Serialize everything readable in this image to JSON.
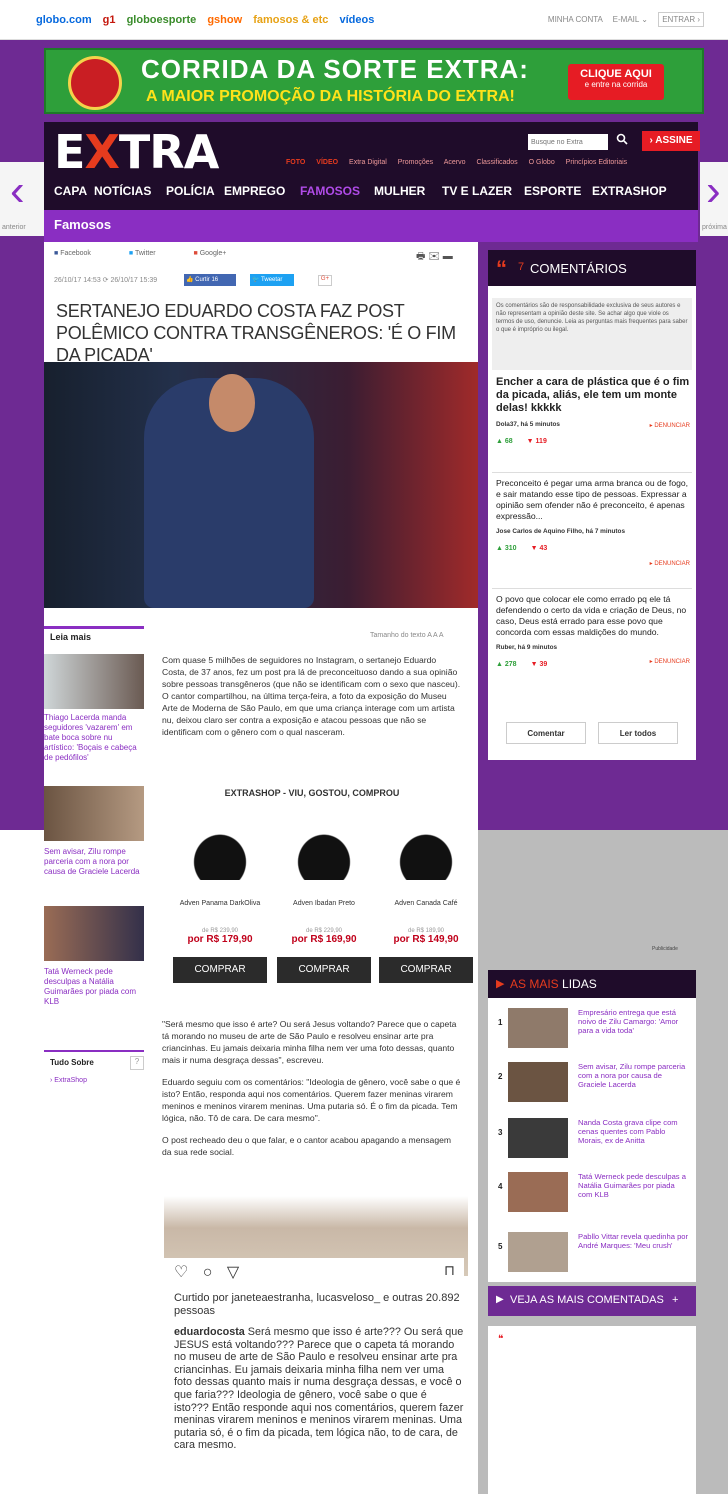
{
  "topbar": {
    "links": [
      "globo.com",
      "g1",
      "globoesporte",
      "gshow",
      "famosos & etc",
      "vídeos"
    ],
    "right": [
      "MINHA CONTA",
      "E-MAIL ⌄",
      "ENTRAR ›"
    ]
  },
  "banner": {
    "title": "CORRIDA DA SORTE EXTRA:",
    "subtitle": "A MAIOR PROMOÇÃO DA HISTÓRIA DO EXTRA!",
    "btn_title": "CLIQUE AQUI",
    "btn_sub": "e entre na corrida",
    "seal": "CORRIDA DA SORTE EXTRA"
  },
  "header": {
    "logo_e": "E",
    "logo_x": "X",
    "logo_rest": "TRA",
    "search_placeholder": "Busque no Extra",
    "assine": "› ASSINE",
    "subnav": [
      "FOTO",
      "VÍDEO",
      "Extra Digital",
      "Promoções",
      "Acervo",
      "Classificados",
      "O Globo",
      "Princípios Editoriais"
    ]
  },
  "mainnav": [
    "CAPA",
    "NOTÍCIAS",
    "POLÍCIA",
    "EMPREGO",
    "FAMOSOS",
    "MULHER",
    "TV E LAZER",
    "ESPORTE",
    "EXTRASHOP"
  ],
  "section": "Famosos",
  "arrows": {
    "prev": "anterior",
    "next": "próxima"
  },
  "share": {
    "facebook": "Facebook",
    "twitter": "Twitter",
    "google": "Google+",
    "dates": "26/10/17 14:53  ⟳ 26/10/17 15:39",
    "curtir": "👍 Curtir 16",
    "tweet": "🐦 Tweetar",
    "g1": "G+"
  },
  "headline": "SERTANEJO EDUARDO COSTA FAZ POST POLÊMICO CONTRA TRANSGÊNEROS: 'É O FIM DA PICADA'",
  "leia_mais": {
    "title": "Leia mais",
    "items": [
      "Thiago Lacerda manda seguidores 'vazarem' em bate boca sobre nu artístico: 'Boçais e cabeça de pedófilos'",
      "Sem avisar, Zilu rompe parceria com a nora por causa de Graciele Lacerda",
      "Tatá Werneck pede desculpas a Natália Guimarães por piada com KLB"
    ]
  },
  "tamanho": "Tamanho do texto  A  A  A",
  "body1": "Com quase 5 milhões de seguidores no Instagram, o sertanejo Eduardo Costa, de 37 anos, fez um post pra lá de preconceituoso dando a sua opinião sobre pessoas transgêneros (que não se identificam com o sexo que nasceu). O cantor compartilhou, na última terça-feira, a foto da exposição do Museu Arte de Moderna de São Paulo, em que uma criança interage com um artista nu, deixou claro ser contra a exposição e atacou pessoas que não se identificam com o gênero com o qual nasceram.",
  "shop": {
    "title": "EXTRASHOP - VIU, GOSTOU, COMPROU",
    "products": [
      {
        "name": "Adven Panama DarkOliva",
        "old": "de R$ 239,90",
        "price": "por R$ 179,90",
        "buy": "COMPRAR"
      },
      {
        "name": "Adven Ibadan Preto",
        "old": "de R$ 229,90",
        "price": "por R$ 169,90",
        "buy": "COMPRAR"
      },
      {
        "name": "Adven Canada Café",
        "old": "de R$ 189,90",
        "price": "por R$ 149,90",
        "buy": "COMPRAR"
      }
    ]
  },
  "body2": [
    "\"Será mesmo que isso é arte? Ou será Jesus voltando? Parece que o capeta tá morando no museu de arte de São Paulo e resolveu ensinar arte pra criancinhas. Eu jamais deixaria minha filha nem ver uma foto dessas, quanto mais ir numa desgraça dessas\", escreveu.",
    "Eduardo seguiu com os comentários: \"Ideologia de gênero, você sabe o que é isto? Então, responda aqui nos comentários. Querem fazer meninas virarem meninos e meninos virarem meninas. Uma putaria só. É o fim da picada. Tem lógica, não. Tô de cara. De cara mesmo\".",
    "O post recheado deu o que falar, e o cantor acabou apagando a mensagem da sua rede social."
  ],
  "tudo": {
    "title": "Tudo Sobre",
    "q": "?",
    "item": "› ExtraShop"
  },
  "insta": {
    "curtido": "Curtido por janeteaestranha, lucasveloso_ e outras 20.892 pessoas",
    "user": "eduardocosta",
    "caption": "Será mesmo que isso é arte??? Ou será que JESUS está voltando??? Parece que o capeta tá morando no museu  de arte de São Paulo e resolveu ensinar arte pra criancinhas. Eu jamais deixaria minha filha nem ver uma foto dessas quanto mais ir numa desgraça dessas, e você o que faria??? Ideologia de gênero, você sabe o que é isto??? Então responde aqui nos comentários, querem fazer meninas virarem meninos e meninos virarem meninas. Uma putaria só, é o fim da picada, tem lógica não, to de cara, de cara mesmo."
  },
  "comments": {
    "count": "7",
    "title": "COMENTÁRIOS",
    "disclaimer": "Os comentários são de responsabilidade exclusiva de seus autores e não representam a opinião deste site. Se achar algo que viole os termos de uso, denuncie. Leia as perguntas mais frequentes para saber o que é impróprio ou ilegal.",
    "denunciar": "▸ DENUNCIAR",
    "items": [
      {
        "text": "Encher a cara de plástica que é o fim da picada, aliás, ele tem um monte delas! kkkkk",
        "author": "Dola37, há 5 minutos",
        "up": "68",
        "down": "119"
      },
      {
        "text": "Preconceito é pegar uma arma branca ou de fogo, e sair matando esse tipo de pessoas. Expressar a opinião sem ofender não é preconceito, é apenas expressão...",
        "author": "Jose Carlos de Aquino Filho, há 7 minutos",
        "up": "310",
        "down": "43"
      },
      {
        "text": "O povo que colocar ele como errado pq ele tá defendendo o certo da vida e criação de Deus, no caso, Deus está errado para esse povo que concorda com essas maldições do mundo.",
        "author": "Ruber, há 9 minutos",
        "up": "278",
        "down": "39"
      }
    ],
    "comentar": "Comentar",
    "ler": "Ler todos"
  },
  "publicidade": "Publicidade",
  "lidas": {
    "title_a": "AS MAIS",
    "title_b": " LIDAS",
    "items": [
      {
        "n": "1",
        "t": "Empresário entrega que está noivo de Zilu Camargo: 'Amor para a vida toda'"
      },
      {
        "n": "2",
        "t": "Sem avisar, Zilu rompe parceria com a nora por causa de Graciele Lacerda"
      },
      {
        "n": "3",
        "t": "Nanda Costa grava clipe com cenas quentes com Pablo Morais, ex de Anitta"
      },
      {
        "n": "4",
        "t": "Tatá Werneck pede desculpas a Natália Guimarães por piada com KLB"
      },
      {
        "n": "5",
        "t": "Pabllo Vittar revela quedinha por André Marques: 'Meu crush'"
      }
    ]
  },
  "veja": {
    "title": "VEJA AS MAIS COMENTADAS",
    "plus": "+"
  }
}
